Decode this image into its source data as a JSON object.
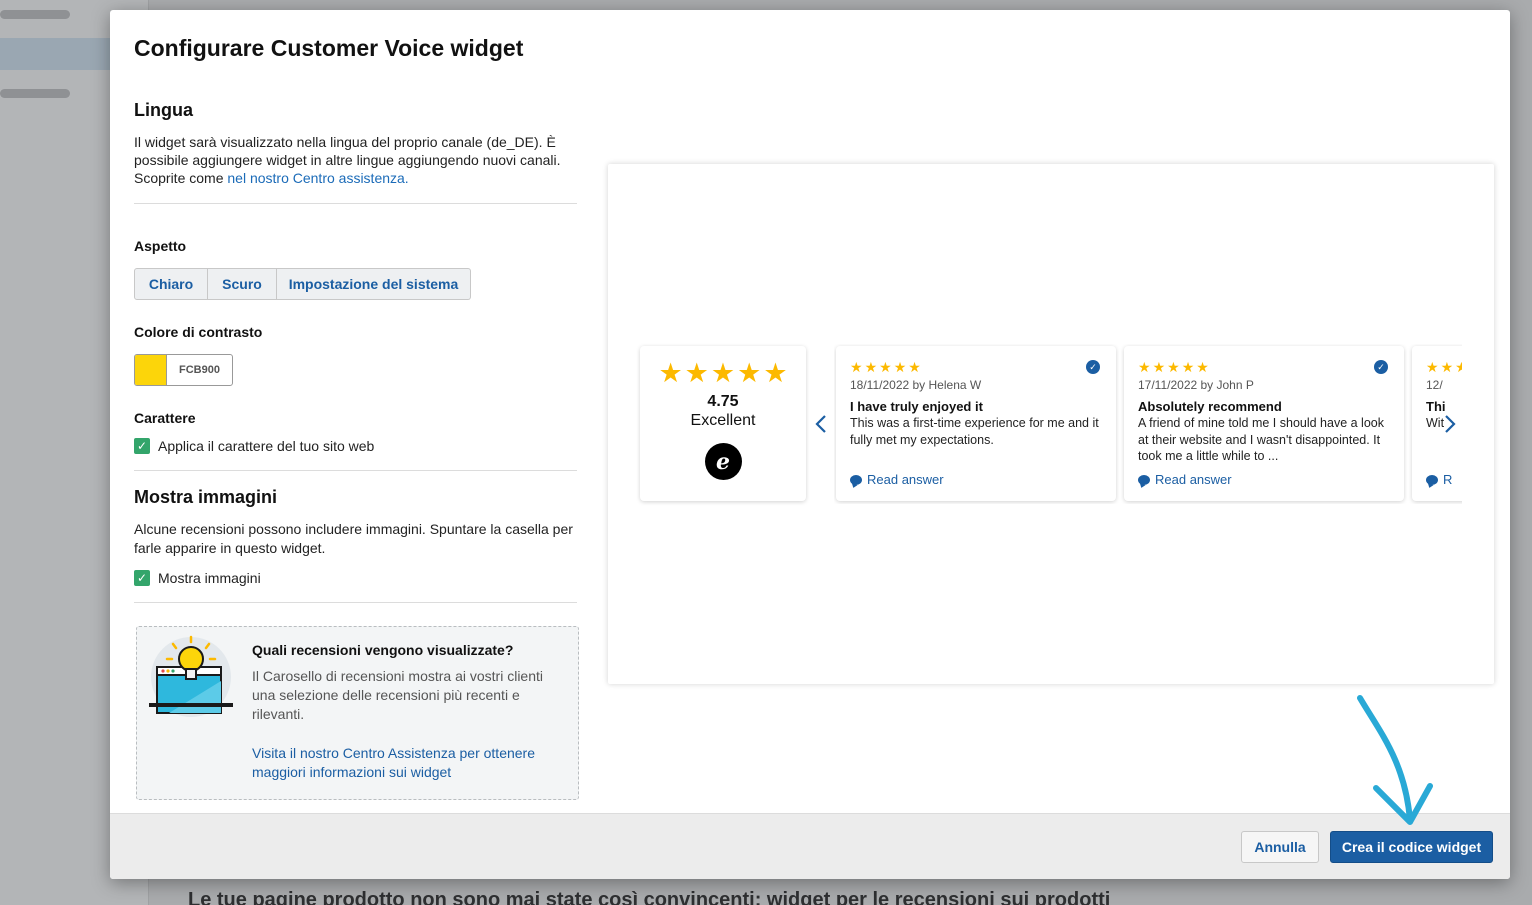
{
  "background": {
    "page_heading": "Le tue pagine prodotto non sono mai state così convincenti: widget per le recensioni sui prodotti"
  },
  "modal": {
    "title": "Configurare Customer Voice widget",
    "language": {
      "heading": "Lingua",
      "text": "Il widget sarà visualizzato nella lingua del proprio canale (de_DE). È possibile aggiungere widget in altre lingue aggiungendo nuovi canali. Scoprite come ",
      "link": "nel nostro Centro assistenza."
    },
    "appearance": {
      "label": "Aspetto",
      "options": [
        "Chiaro",
        "Scuro",
        "Impostazione del sistema"
      ]
    },
    "contrast": {
      "label": "Colore di contrasto",
      "value": "FCB900",
      "swatch_color": "#fcd50a"
    },
    "font": {
      "label": "Carattere",
      "checkbox_label": "Applica il carattere del tuo sito web",
      "checked": true
    },
    "images": {
      "heading": "Mostra immagini",
      "text": "Alcune recensioni possono includere immagini. Spuntare la casella per farle apparire in questo widget.",
      "checkbox_label": "Mostra immagini",
      "checked": true
    },
    "info": {
      "title": "Quali recensioni vengono visualizzate?",
      "text": "Il Carosello di recensioni mostra ai vostri clienti una selezione delle recensioni più recenti e rilevanti.",
      "link": "Visita il nostro Centro Assistenza per ottenere maggiori informazioni sui widget"
    },
    "preview": {
      "summary": {
        "rating": 5,
        "score": "4.75",
        "label": "Excellent",
        "logo_letter": "e"
      },
      "reviews": [
        {
          "rating": 5,
          "date": "18/11/2022 by Helena W",
          "title": "I have truly enjoyed it",
          "body": "This was a first-time experience for me and it fully met my expectations.",
          "action": "Read answer"
        },
        {
          "rating": 5,
          "date": "17/11/2022 by John P",
          "title": "Absolutely recommend",
          "body": "A friend of mine told me I should have a look at their website and I wasn't disappointed. It took me a little while to ...",
          "action": "Read answer"
        },
        {
          "rating": 5,
          "date": "12/",
          "title": "Thi",
          "body": "Wit",
          "action": "R"
        }
      ]
    },
    "footer": {
      "cancel": "Annulla",
      "submit": "Crea il codice widget"
    }
  },
  "colors": {
    "accent": "#1b5ea3",
    "star": "#fcb900",
    "check": "#33a56b",
    "annotation_arrow": "#29a9d6"
  }
}
